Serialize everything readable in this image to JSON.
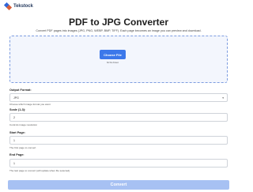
{
  "brand": {
    "name": "Tekstock"
  },
  "header": {
    "title": "PDF to JPG Converter",
    "subtitle": "Convert PDF pages into images (JPG, PNG, WEBP, BMP, TIFF). Each page becomes an image you can preview and download."
  },
  "upload": {
    "button_label": "Choose File",
    "status": "No file chosen"
  },
  "form": {
    "output_format": {
      "label": "Output Format:",
      "value": "JPG",
      "help": "Choose which image format you want"
    },
    "scale": {
      "label": "Scale (1-3):",
      "value": "2",
      "help": "Controls image resolution"
    },
    "start_page": {
      "label": "Start Page:",
      "value": "1",
      "help": "The first page to convert"
    },
    "end_page": {
      "label": "End Page:",
      "value": "1",
      "help": "The last page to convert (will update when file selected)"
    }
  },
  "actions": {
    "convert_label": "Convert"
  }
}
